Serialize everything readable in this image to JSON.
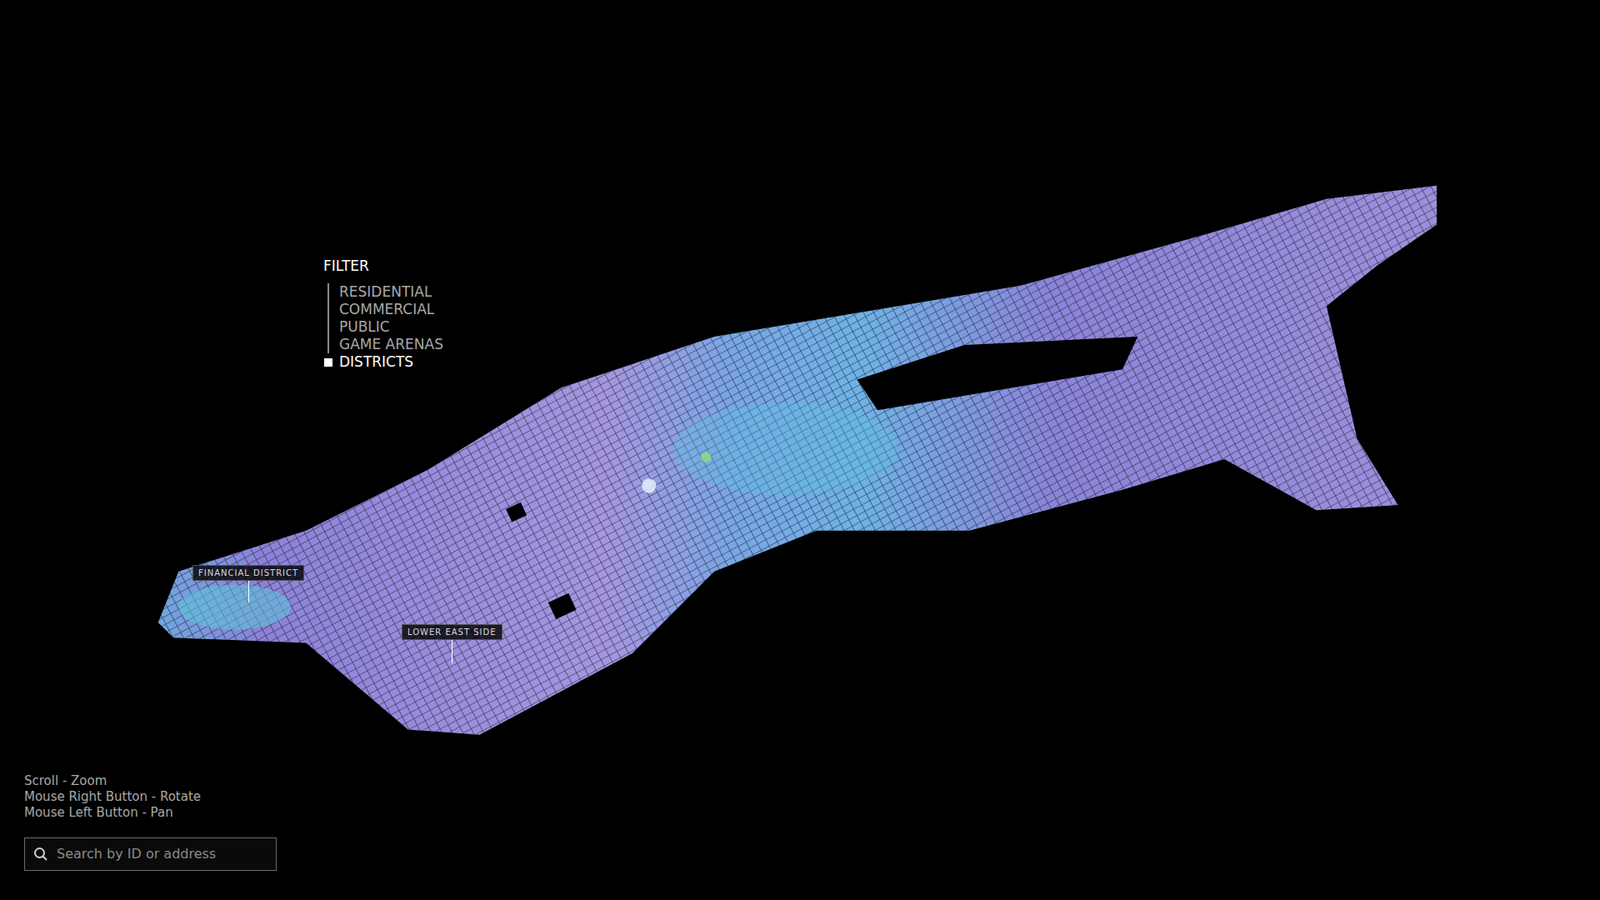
{
  "filter": {
    "title": "FILTER",
    "items": [
      {
        "label": "RESIDENTIAL",
        "selected": false
      },
      {
        "label": "COMMERCIAL",
        "selected": false
      },
      {
        "label": "PUBLIC",
        "selected": false
      },
      {
        "label": "GAME ARENAS",
        "selected": false
      },
      {
        "label": "DISTRICTS",
        "selected": true
      }
    ]
  },
  "districts": [
    {
      "label": "FINANCIAL DISTRICT"
    },
    {
      "label": "LOWER EAST SIDE"
    }
  ],
  "controls": [
    "Scroll - Zoom",
    "Mouse Right Button - Rotate",
    "Mouse Left Button - Pan"
  ],
  "search": {
    "placeholder": "Search by ID or address"
  }
}
